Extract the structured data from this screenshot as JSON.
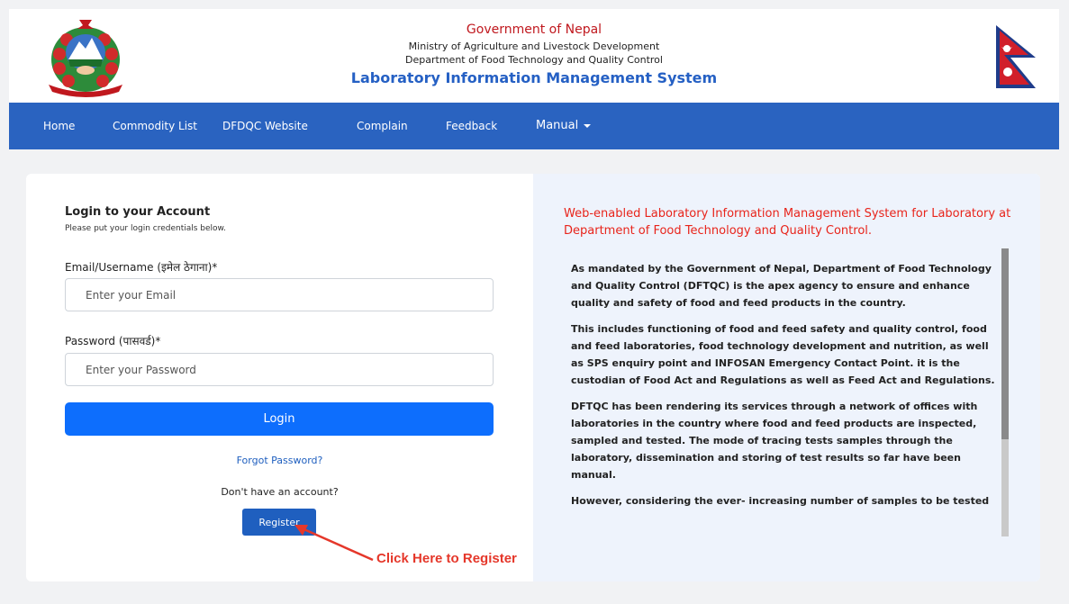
{
  "header": {
    "government": "Government of Nepal",
    "ministry": "Ministry of Agriculture and Livestock Development",
    "department": "Department of Food Technology and Quality Control",
    "system_title": "Laboratory Information Management System",
    "emblem_icon": "nepal-emblem-icon",
    "flag_icon": "nepal-flag-icon"
  },
  "nav": {
    "items": [
      "Home",
      "Commodity List",
      "DFDQC Website",
      "Complain",
      "Feedback"
    ],
    "manual_label": "Manual"
  },
  "login": {
    "title": "Login to your Account",
    "subtitle": "Please put your login credentials below.",
    "email_label": "Email/Username (इमेल ठेगाना)*",
    "email_placeholder": "Enter your Email",
    "password_label": "Password (पासवर्ड)*",
    "password_placeholder": "Enter your Password",
    "login_button": "Login",
    "forgot_password": "Forgot Password?",
    "no_account": "Don't have an account?",
    "register_button": "Register"
  },
  "annotation": {
    "text": "Click Here to Register",
    "color": "#e5372a"
  },
  "info": {
    "heading": "Web-enabled Laboratory Information Management System for Laboratory at Department of Food Technology and Quality Control.",
    "paragraphs": [
      "As mandated by the Government of Nepal, Department of Food Technology and Quality Control (DFTQC) is the apex agency to ensure and enhance quality and safety of food and feed products in the country.",
      "This includes functioning of food and feed safety and quality control, food and feed laboratories, food technology development and nutrition, as well as SPS enquiry point and INFOSAN Emergency Contact Point. it is the custodian of Food Act and Regulations as well as Feed Act and Regulations.",
      "DFTQC has been rendering its services through a network of offices with laboratories in the country where food and feed products are inspected, sampled and tested. The mode of tracing tests samples through the laboratory, dissemination and storing of test results so far have been manual.",
      "However, considering the ever- increasing number of samples to be tested"
    ]
  },
  "colors": {
    "nav_bg": "#2a63c0",
    "login_button": "#0d6efd",
    "register_button": "#1f5fbf",
    "heading_red": "#e8241b",
    "system_title_blue": "#2560c4"
  }
}
